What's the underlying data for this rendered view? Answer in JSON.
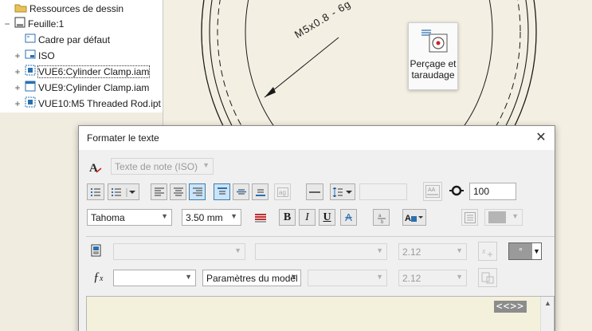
{
  "browser": {
    "items": [
      {
        "label": "Ressources de dessin",
        "icon": "folder-icon",
        "expander": ""
      },
      {
        "label": "Feuille:1",
        "icon": "sheet-icon",
        "expander": "−"
      },
      {
        "label": "Cadre par défaut",
        "icon": "border-icon",
        "expander": ""
      },
      {
        "label": "ISO",
        "icon": "title-block-icon",
        "expander": "+"
      },
      {
        "label": "VUE6:Cylinder Clamp.iam",
        "icon": "view-icon",
        "expander": "+"
      },
      {
        "label": "VUE9:Cylinder Clamp.iam",
        "icon": "view-icon",
        "expander": "+"
      },
      {
        "label": "VUE10:M5 Threaded Rod.ipt",
        "icon": "view-icon",
        "expander": "+"
      }
    ]
  },
  "canvas": {
    "thread_note": "M5x0.8 - 6g"
  },
  "tooltip": {
    "line1": "Perçage et",
    "line2": "taraudage"
  },
  "dialog": {
    "title": "Formater le texte",
    "close_glyph": "✕",
    "text_style": "Texte de note (ISO)",
    "stretch_value": "100",
    "font": "Tahoma",
    "font_size": "3.50 mm",
    "bold": "B",
    "italic": "I",
    "underline": "U",
    "strike": "A",
    "precision1": "2.12",
    "precision2": "2.12",
    "symbol_value": "°",
    "parameters_source": "Paramètres du modèl",
    "placeholder_text": "<<>>",
    "colors": {
      "accent": "#3c7fb1",
      "editor_bg": "#f3f1dc"
    }
  }
}
